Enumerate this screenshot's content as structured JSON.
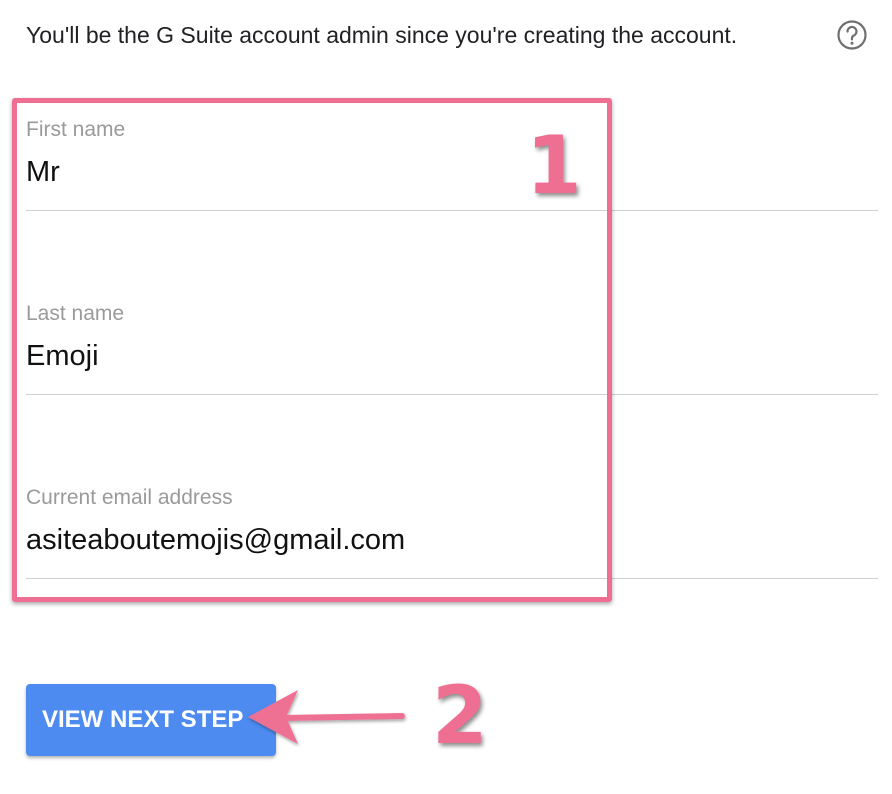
{
  "intro_text": "You'll be the G Suite account admin since you're creating the account.",
  "help_icon": "question-circle-icon",
  "form": {
    "first_name": {
      "label": "First name",
      "value": "Mr"
    },
    "last_name": {
      "label": "Last name",
      "value": "Emoji"
    },
    "email": {
      "label": "Current email address",
      "value": "asiteaboutemojis@gmail.com"
    }
  },
  "next_button_label": "VIEW NEXT STEP",
  "annotations": {
    "step_1": "1",
    "step_2": "2",
    "color": "#ee6f92"
  },
  "accent_color": "#4d8bf0"
}
